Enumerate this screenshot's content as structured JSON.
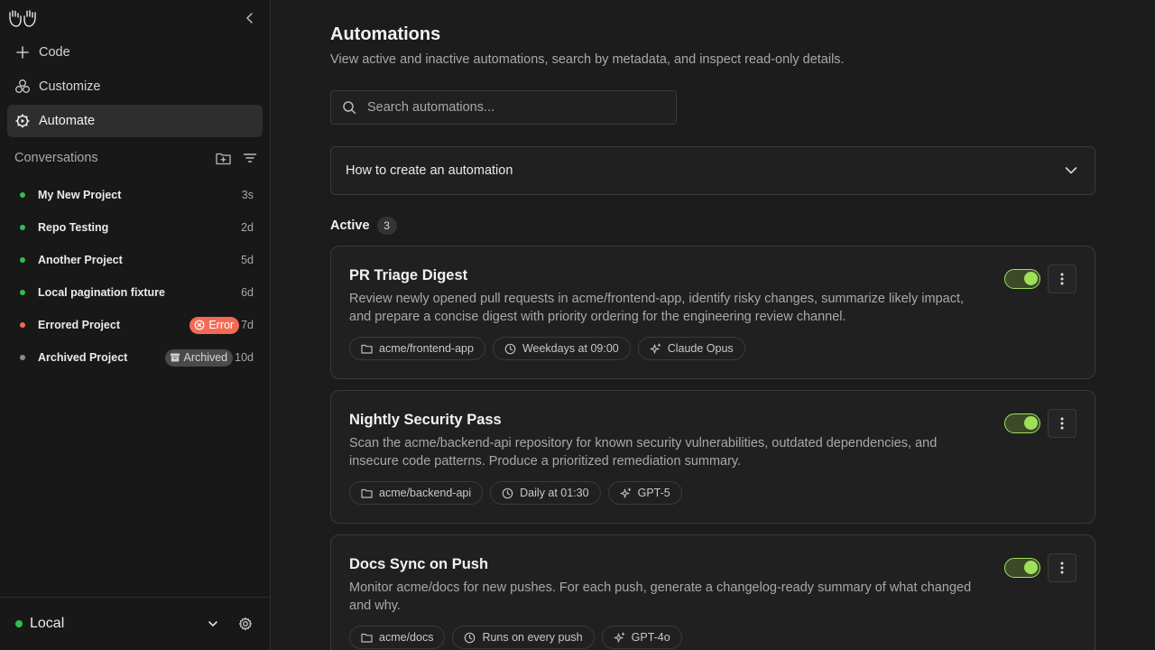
{
  "sidebar": {
    "nav": [
      {
        "label": "Code",
        "icon": "plus-icon"
      },
      {
        "label": "Customize",
        "icon": "customize-icon"
      },
      {
        "label": "Automate",
        "icon": "automate-icon",
        "active": true
      }
    ],
    "conversations_title": "Conversations",
    "conversations": [
      {
        "name": "My New Project",
        "time": "3s",
        "status": "green"
      },
      {
        "name": "Repo Testing",
        "time": "2d",
        "status": "green"
      },
      {
        "name": "Another Project",
        "time": "5d",
        "status": "green"
      },
      {
        "name": "Local pagination fixture",
        "time": "6d",
        "status": "green"
      },
      {
        "name": "Errored Project",
        "time": "7d",
        "status": "red",
        "badge": "Error"
      },
      {
        "name": "Archived Project",
        "time": "10d",
        "status": "gray",
        "badge": "Archived"
      }
    ],
    "footer": {
      "env_label": "Local"
    }
  },
  "colors": {
    "green": "#2fbf4f",
    "red": "#f26a55",
    "gray": "#8a8a8a",
    "accent": "#9ee05a"
  },
  "main": {
    "title": "Automations",
    "subtitle": "View active and inactive automations, search by metadata, and inspect read-only details.",
    "search": {
      "placeholder": "Search automations...",
      "value": ""
    },
    "howto_label": "How to create an automation",
    "active_label": "Active",
    "active_count": "3",
    "automations": [
      {
        "title": "PR Triage Digest",
        "description": "Review newly opened pull requests in acme/frontend-app, identify risky changes, summarize likely impact, and prepare a concise digest with priority ordering for the engineering review channel.",
        "repo": "acme/frontend-app",
        "schedule": "Weekdays at 09:00",
        "model": "Claude Opus",
        "enabled": true
      },
      {
        "title": "Nightly Security Pass",
        "description": "Scan the acme/backend-api repository for known security vulnerabilities, outdated dependencies, and insecure code patterns. Produce a prioritized remediation summary.",
        "repo": "acme/backend-api",
        "schedule": "Daily at 01:30",
        "model": "GPT-5",
        "enabled": true
      },
      {
        "title": "Docs Sync on Push",
        "description": "Monitor acme/docs for new pushes. For each push, generate a changelog-ready summary of what changed and why.",
        "repo": "acme/docs",
        "schedule": "Runs on every push",
        "model": "GPT-4o",
        "enabled": true
      }
    ]
  }
}
